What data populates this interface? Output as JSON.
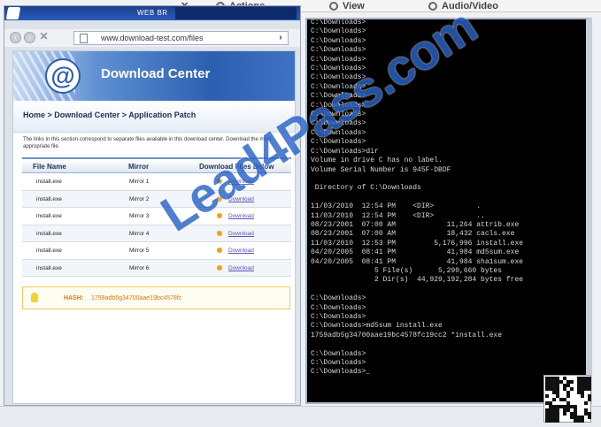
{
  "browser": {
    "title": "WEB BR",
    "url": "www.download-test.com/files",
    "go_label": "›"
  },
  "page": {
    "header_logo": "@",
    "header_title": "Download Center",
    "breadcrumb": "Home > Download Center > Application Patch",
    "description": "The links in this section correspond to separate files available in this download center. Download the most appropriate file.",
    "columns": [
      "File Name",
      "Mirror",
      "Download Files Below"
    ],
    "rows": [
      {
        "file": "install.exe",
        "mirror": "Mirror 1",
        "link": "Download"
      },
      {
        "file": "install.exe",
        "mirror": "Mirror 2",
        "link": "Download"
      },
      {
        "file": "install.exe",
        "mirror": "Mirror 3",
        "link": "Download"
      },
      {
        "file": "install.exe",
        "mirror": "Mirror 4",
        "link": "Download"
      },
      {
        "file": "install.exe",
        "mirror": "Mirror 5",
        "link": "Download"
      },
      {
        "file": "install.exe",
        "mirror": "Mirror 6",
        "link": "Download"
      }
    ],
    "hash_label": "HASH:",
    "hash_value": "1759adb5g34700aae19bc4578fc"
  },
  "toolbar": {
    "actions": "Actions",
    "view": "View",
    "audio_video": "Audio/Video"
  },
  "terminal": {
    "lines": [
      "C:\\Downloads>",
      "C:\\Downloads>",
      "C:\\Downloads>",
      "C:\\Downloads>",
      "C:\\Downloads>",
      "C:\\Downloads>",
      "C:\\Downloads>",
      "C:\\Downloads>",
      "C:\\Downloads>",
      "C:\\Downloads>",
      "C:\\Downloads>",
      "C:\\Downloads>",
      "C:\\Downloads>",
      "C:\\Downloads>",
      "C:\\Downloads>dir",
      "Volume in drive C has no label.",
      "Volume Serial Number is 945F-DBDF",
      "",
      " Directory of C:\\Downloads",
      "",
      "11/03/2010  12:54 PM    <DIR>          .",
      "11/03/2010  12:54 PM    <DIR>          ..",
      "08/23/2001  07:00 AM            11,264 attrib.exe",
      "08/23/2001  07:00 AM            18,432 cacls.exe",
      "11/03/2010  12:53 PM         5,176,996 install.exe",
      "04/20/2005  08:41 PM            41,984 md5sum.exe",
      "04/20/2005  08:41 PM            41,984 sha1sum.exe",
      "               5 File(s)      5,290,660 bytes",
      "               2 Dir(s)  44,929,192,284 bytes free",
      "",
      "C:\\Downloads>",
      "C:\\Downloads>",
      "C:\\Downloads>",
      "C:\\Downloads>md5sum install.exe",
      "1759adb5g34700aae19bc4578fc19cc2 *install.exe",
      "",
      "C:\\Downloads>",
      "C:\\Downloads>",
      "C:\\Downloads>_"
    ]
  },
  "watermark": "Lead4Pass.com"
}
